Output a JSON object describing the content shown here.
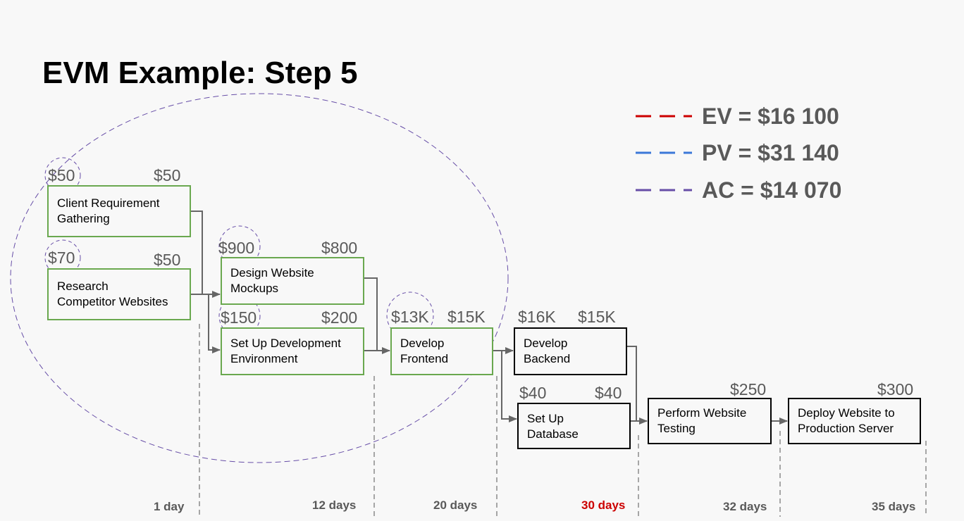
{
  "title": "EVM Example: Step 5",
  "legend": [
    {
      "label": "EV = $16 100",
      "color": "#cc0000"
    },
    {
      "label": "PV = $31 140",
      "color": "#3c78d8"
    },
    {
      "label": "AC = $14 070",
      "color": "#674ea7"
    }
  ],
  "tasks": [
    {
      "id": "client-requirement-gathering",
      "lines": [
        "Client Requirement",
        "Gathering"
      ],
      "actual_cost": "$50",
      "planned_cost": "$50",
      "status": "complete"
    },
    {
      "id": "research-competitor-websites",
      "lines": [
        "Research",
        "Competitor Websites"
      ],
      "actual_cost": "$70",
      "planned_cost": "$50",
      "status": "complete"
    },
    {
      "id": "design-website-mockups",
      "lines": [
        "Design Website",
        "Mockups"
      ],
      "actual_cost": "$900",
      "planned_cost": "$800",
      "status": "complete"
    },
    {
      "id": "set-up-development-environment",
      "lines": [
        "Set Up Development",
        "Environment"
      ],
      "actual_cost": "$150",
      "planned_cost": "$200",
      "status": "complete"
    },
    {
      "id": "develop-frontend",
      "lines": [
        "Develop",
        "Frontend"
      ],
      "actual_cost": "$13K",
      "planned_cost": "$15K",
      "status": "complete"
    },
    {
      "id": "develop-backend",
      "lines": [
        "Develop",
        "Backend"
      ],
      "actual_cost": "$16K",
      "planned_cost": "$15K",
      "status": "incomplete"
    },
    {
      "id": "set-up-database",
      "lines": [
        "Set Up",
        "Database"
      ],
      "actual_cost": "$40",
      "planned_cost": "$40",
      "status": "incomplete"
    },
    {
      "id": "perform-website-testing",
      "lines": [
        "Perform Website",
        "Testing"
      ],
      "planned_cost": "$250",
      "status": "incomplete"
    },
    {
      "id": "deploy-website-to-production-server",
      "lines": [
        "Deploy Website to",
        "Production Server"
      ],
      "planned_cost": "$300",
      "status": "incomplete"
    }
  ],
  "timeline": [
    {
      "label": "1 day",
      "current": false
    },
    {
      "label": "12 days",
      "current": false
    },
    {
      "label": "20 days",
      "current": false
    },
    {
      "label": "30 days",
      "current": true
    },
    {
      "label": "32 days",
      "current": false
    },
    {
      "label": "35 days",
      "current": false
    }
  ],
  "colors": {
    "complete_border": "#6aa84f",
    "incomplete_border": "#000000",
    "connector": "#666666",
    "actual_cost_circle": "#674ea7",
    "current_day": "#cc0000"
  }
}
